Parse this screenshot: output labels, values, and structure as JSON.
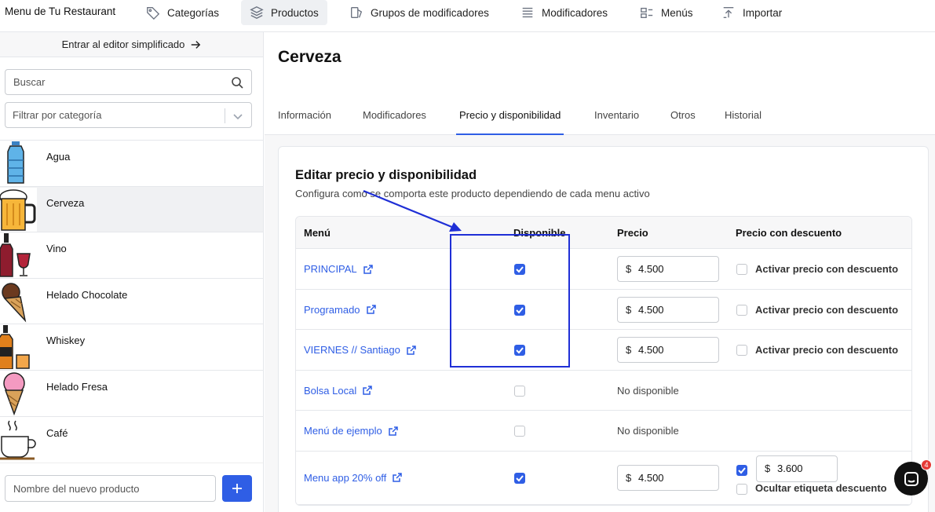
{
  "nav": {
    "brand": "Menu de Tu Restaurant",
    "items": [
      {
        "label": "Categorías",
        "icon": "tag-icon"
      },
      {
        "label": "Productos",
        "icon": "layers-icon",
        "active": true
      },
      {
        "label": "Grupos de modificadores",
        "icon": "modifier-groups-icon"
      },
      {
        "label": "Modificadores",
        "icon": "list-icon"
      },
      {
        "label": "Menús",
        "icon": "menus-icon"
      },
      {
        "label": "Importar",
        "icon": "import-icon"
      }
    ]
  },
  "sidebar": {
    "simplified_editor": "Entrar al editor simplificado",
    "search_placeholder": "Buscar",
    "category_filter_placeholder": "Filtrar por categoría",
    "products": [
      {
        "name": "Agua",
        "icon": "water-bottle-icon"
      },
      {
        "name": "Cerveza",
        "icon": "beer-mug-icon",
        "selected": true
      },
      {
        "name": "Vino",
        "icon": "wine-icon"
      },
      {
        "name": "Helado Chocolate",
        "icon": "chocolate-ice-cream-icon"
      },
      {
        "name": "Whiskey",
        "icon": "whiskey-icon"
      },
      {
        "name": "Helado Fresa",
        "icon": "strawberry-ice-cream-icon"
      },
      {
        "name": "Café",
        "icon": "coffee-cup-icon"
      }
    ],
    "new_product_placeholder": "Nombre del nuevo producto"
  },
  "main": {
    "title": "Cerveza",
    "tabs": [
      {
        "label": "Información"
      },
      {
        "label": "Modificadores"
      },
      {
        "label": "Precio y disponibilidad",
        "active": true
      },
      {
        "label": "Inventario"
      },
      {
        "label": "Otros"
      },
      {
        "label": "Historial"
      }
    ],
    "card": {
      "title": "Editar precio y disponibilidad",
      "subtitle": "Configura como se comporta este producto dependiendo de cada menu activo",
      "columns": [
        "Menú",
        "Disponible",
        "Precio",
        "Precio con descuento"
      ],
      "rows": [
        {
          "menu": "PRINCIPAL",
          "available": true,
          "currency": "$",
          "price": "4.500",
          "discount_label": "Activar precio con descuento",
          "discount_on": false
        },
        {
          "menu": "Programado",
          "available": true,
          "currency": "$",
          "price": "4.500",
          "discount_label": "Activar precio con descuento",
          "discount_on": false
        },
        {
          "menu": "VIERNES // Santiago",
          "available": true,
          "currency": "$",
          "price": "4.500",
          "discount_label": "Activar precio con descuento",
          "discount_on": false
        },
        {
          "menu": "Bolsa Local",
          "available": false,
          "not_available": "No disponible"
        },
        {
          "menu": "Menú de ejemplo",
          "available": false,
          "not_available": "No disponible"
        },
        {
          "menu": "Menu app 20% off",
          "available": true,
          "currency": "$",
          "price": "4.500",
          "discount_on": true,
          "discount_price": "3.600",
          "hide_label": "Ocultar etiqueta descuento"
        }
      ]
    }
  },
  "chat": {
    "badge": "4"
  },
  "colors": {
    "accent": "#2f5ee5",
    "annotation": "#1f2fd6",
    "badge": "#e53935"
  }
}
